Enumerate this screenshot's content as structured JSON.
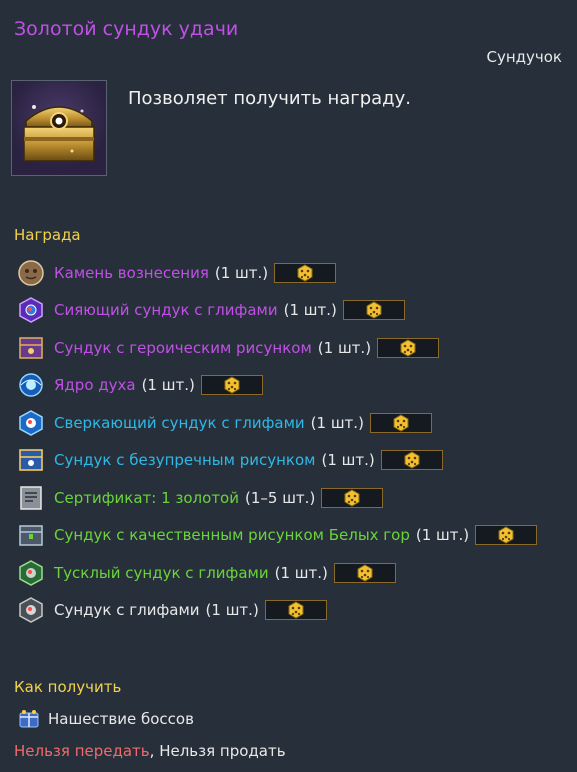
{
  "tooltip": {
    "title": "Золотой сундук удачи",
    "category": "Сундучок",
    "description": "Позволяет получить награду.",
    "reward_header": "Награда",
    "how_to_get_header": "Как получить",
    "source": "Нашествие боссов",
    "no_transfer": "Нельзя передать",
    "separator": ", ",
    "no_sell": "Нельзя продать"
  },
  "rewards": [
    {
      "name": "Камень вознесения",
      "qty": "(1 шт.)",
      "color": "#c24fe8",
      "icon": "ascension-stone-icon"
    },
    {
      "name": "Сияющий сундук с глифами",
      "qty": "(1 шт.)",
      "color": "#c24fe8",
      "icon": "radiant-glyph-chest-icon"
    },
    {
      "name": "Сундук с героическим рисунком",
      "qty": "(1 шт.)",
      "color": "#c24fe8",
      "icon": "heroic-pattern-chest-icon"
    },
    {
      "name": "Ядро духа",
      "qty": "(1 шт.)",
      "color": "#c24fe8",
      "icon": "spirit-core-icon"
    },
    {
      "name": "Сверкающий сундук с глифами",
      "qty": "(1 шт.)",
      "color": "#2fb8e6",
      "icon": "sparkling-glyph-chest-icon"
    },
    {
      "name": "Сундук с безупречным рисунком",
      "qty": "(1 шт.)",
      "color": "#2fb8e6",
      "icon": "flawless-pattern-chest-icon"
    },
    {
      "name": "Сертификат: 1 золотой",
      "qty": "(1–5 шт.)",
      "color": "#6ad43a",
      "icon": "certificate-icon"
    },
    {
      "name": "Сундук с качественным рисунком Белых гор",
      "qty": "(1 шт.)",
      "color": "#6ad43a",
      "icon": "quality-pattern-chest-icon"
    },
    {
      "name": "Тусклый сундук с глифами",
      "qty": "(1 шт.)",
      "color": "#6ad43a",
      "icon": "dull-glyph-chest-icon"
    },
    {
      "name": "Сундук с глифами",
      "qty": "(1 шт.)",
      "color": "#e8e8e8",
      "icon": "glyph-chest-icon"
    }
  ],
  "colors": {
    "epic": "#c24fe8",
    "rare": "#2fb8e6",
    "uncommon": "#6ad43a",
    "common": "#e8e8e8",
    "header": "#f2d24a",
    "warning": "#ef6b6b"
  }
}
